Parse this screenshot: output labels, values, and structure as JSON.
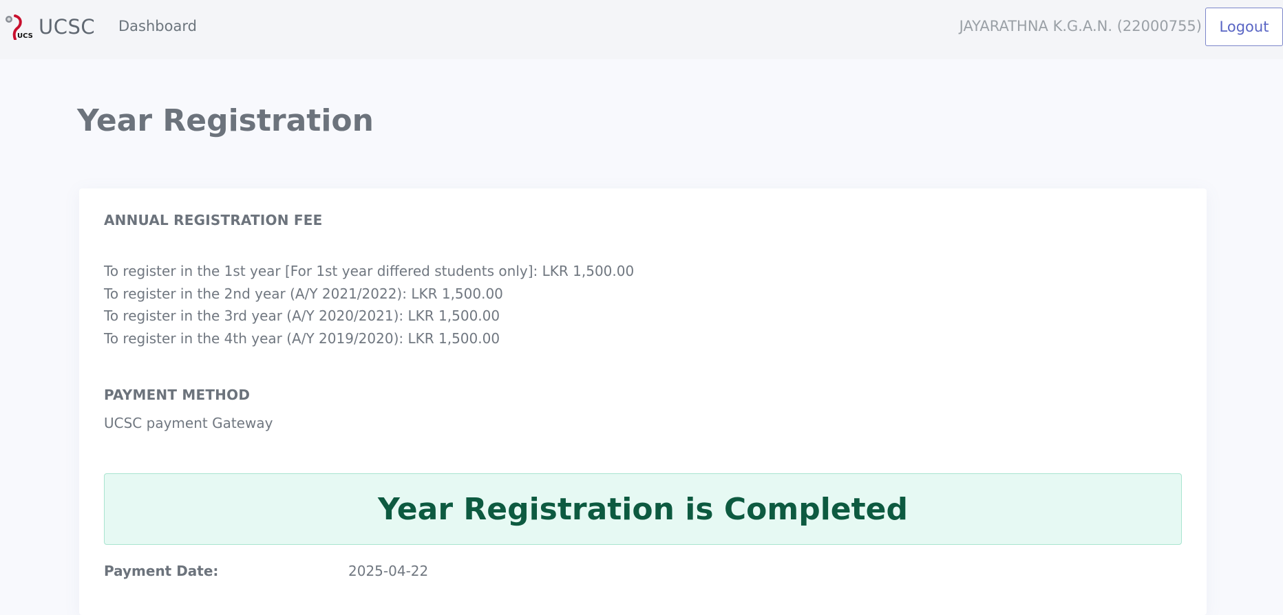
{
  "navbar": {
    "brand_text": "UCSC",
    "dashboard_link": "Dashboard",
    "user_name": "JAYARATHNA K.G.A.N. (22000755)",
    "logout_label": "Logout"
  },
  "page": {
    "title": "Year Registration"
  },
  "fee_section": {
    "title": "ANNUAL REGISTRATION FEE",
    "items": [
      "To register in the 1st year [For 1st year differed students only]: LKR 1,500.00",
      "To register in the 2nd year (A/Y 2021/2022): LKR 1,500.00",
      "To register in the 3rd year (A/Y 2020/2021): LKR 1,500.00",
      "To register in the 4th year (A/Y 2019/2020): LKR 1,500.00"
    ]
  },
  "payment_section": {
    "title": "PAYMENT METHOD",
    "method": "UCSC payment Gateway"
  },
  "status_alert": {
    "message": "Year Registration is Completed"
  },
  "payment_details": {
    "date_label": "Payment Date:",
    "date_value": "2025-04-22"
  },
  "colors": {
    "accent": "#5965c4",
    "success_bg": "#e6f9f3",
    "success_text": "#0d5a40",
    "logo_red": "#c8102e"
  },
  "icons": {
    "brand_logo": "ucsc-logo-icon"
  }
}
